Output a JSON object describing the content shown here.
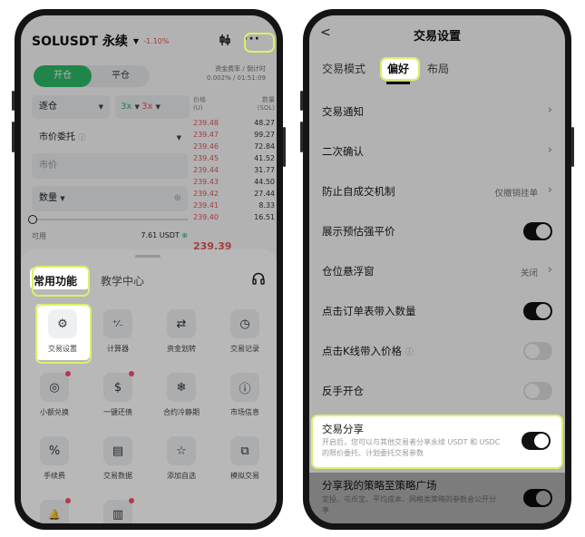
{
  "left": {
    "symbol": "SOLUSDT 永续",
    "change": "-1.10%",
    "open_label": "开仓",
    "close_label": "平仓",
    "funding_label": "资金费率 / 倒计时",
    "funding_value": "0.002% / 01:51:09",
    "margin_mode": "逐仓",
    "leverage_long": "3x",
    "leverage_short": "3x",
    "order_type": "市价委托",
    "price_placeholder": "市价",
    "qty_label": "数量",
    "ob_price_header": "价格",
    "ob_price_unit": "(U)",
    "ob_qty_header": "数量",
    "ob_qty_unit": "(SOL)",
    "orderbook": [
      {
        "price": "239.48",
        "qty": "48.27"
      },
      {
        "price": "239.47",
        "qty": "99.27"
      },
      {
        "price": "239.46",
        "qty": "72.84"
      },
      {
        "price": "239.45",
        "qty": "41.52"
      },
      {
        "price": "239.44",
        "qty": "31.77"
      },
      {
        "price": "239.43",
        "qty": "44.50"
      },
      {
        "price": "239.42",
        "qty": "27.44"
      },
      {
        "price": "239.41",
        "qty": "8.33"
      },
      {
        "price": "239.40",
        "qty": "16.51"
      }
    ],
    "available_label": "可用",
    "available_value": "7.61 USDT",
    "last_price": "239.39",
    "sheet": {
      "tab_common": "常用功能",
      "tab_learn": "教学中心",
      "items": [
        {
          "label": "交易设置",
          "icon": "gear-icon",
          "glyph": "⚙",
          "badge": false
        },
        {
          "label": "计算器",
          "icon": "calculator-icon",
          "glyph": "⁺⁄₋",
          "badge": false
        },
        {
          "label": "资金划转",
          "icon": "transfer-icon",
          "glyph": "⇄",
          "badge": false
        },
        {
          "label": "交易记录",
          "icon": "record-icon",
          "glyph": "◷",
          "badge": false
        },
        {
          "label": "小额兑换",
          "icon": "swap-small-icon",
          "glyph": "◎",
          "badge": true
        },
        {
          "label": "一键还债",
          "icon": "repay-icon",
          "glyph": "$",
          "badge": true
        },
        {
          "label": "合约冷静期",
          "icon": "snowflake-icon",
          "glyph": "❄",
          "badge": false
        },
        {
          "label": "市场信息",
          "icon": "info-icon",
          "glyph": "ⓘ",
          "badge": false
        },
        {
          "label": "手续费",
          "icon": "percent-icon",
          "glyph": "%",
          "badge": false
        },
        {
          "label": "交易数据",
          "icon": "data-icon",
          "glyph": "▤",
          "badge": false
        },
        {
          "label": "添加自选",
          "icon": "star-icon",
          "glyph": "☆",
          "badge": false
        },
        {
          "label": "模拟交易",
          "icon": "simulate-icon",
          "glyph": "⧉",
          "badge": false
        },
        {
          "label": "",
          "icon": "bell-icon",
          "glyph": "🔔",
          "badge": true
        },
        {
          "label": "",
          "icon": "bar-chart-icon",
          "glyph": "▥",
          "badge": true
        }
      ]
    }
  },
  "right": {
    "title": "交易设置",
    "tabs": [
      "交易模式",
      "偏好",
      "布局"
    ],
    "rows": [
      {
        "label": "交易通知",
        "type": "link"
      },
      {
        "label": "二次确认",
        "type": "link"
      },
      {
        "label": "防止自成交机制",
        "type": "link",
        "value": "仅撤销挂单"
      },
      {
        "label": "展示预估强平价",
        "type": "toggle",
        "on": true
      },
      {
        "label": "仓位悬浮窗",
        "type": "link",
        "value": "关闭"
      },
      {
        "label": "点击订单表带入数量",
        "type": "toggle",
        "on": true
      },
      {
        "label": "点击K线带入价格",
        "type": "toggle",
        "on": false,
        "info": true
      },
      {
        "label": "反手开仓",
        "type": "toggle",
        "on": false
      }
    ],
    "share": {
      "label": "交易分享",
      "desc": "开启后，您可以与其他交易者分享永续 USDT 和 USDC 的限价委托、计划委托交易参数",
      "on": true
    },
    "strategy": {
      "label": "分享我的策略至策略广场",
      "desc": "定投、屯币宝、平均成本、网格类策略的参数会公开分享",
      "on": true
    }
  },
  "colors": {
    "accent_green": "#2fbf6a",
    "down_red": "#e85a5a",
    "highlight": "#d6f36a",
    "badge": "#ff4d6d"
  }
}
